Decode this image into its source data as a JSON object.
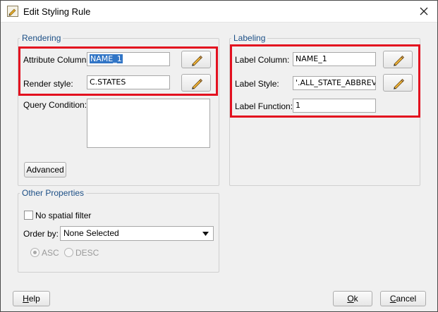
{
  "window": {
    "title": "Edit Styling Rule"
  },
  "rendering": {
    "legend": "Rendering",
    "attribute_columns_label": "Attribute Columns",
    "attribute_columns_value": "NAME_1",
    "render_style_label": "Render style:",
    "render_style_value": "C.STATES",
    "query_condition_label": "Query Condition:",
    "advanced_label": "Advanced"
  },
  "labeling": {
    "legend": "Labeling",
    "label_column_label": "Label Column:",
    "label_column_value": "NAME_1",
    "label_style_label": "Label Style:",
    "label_style_value": "'.ALL_STATE_ABBREVS",
    "label_function_label": "Label Function:",
    "label_function_value": "1"
  },
  "other": {
    "legend": "Other Properties",
    "no_spatial_filter_label": "No spatial filter",
    "order_by_label": "Order by:",
    "order_by_value": "None Selected",
    "asc_label": "ASC",
    "desc_label": "DESC"
  },
  "footer": {
    "help_label": "Help",
    "ok_label": "Ok",
    "cancel_label": "Cancel"
  },
  "colors": {
    "highlight": "#e3101f",
    "legend_text": "#1c4f86",
    "selection": "#3175c6"
  },
  "icons": [
    "app-icon",
    "close-icon",
    "pencil-icon",
    "dropdown-arrow-icon"
  ]
}
